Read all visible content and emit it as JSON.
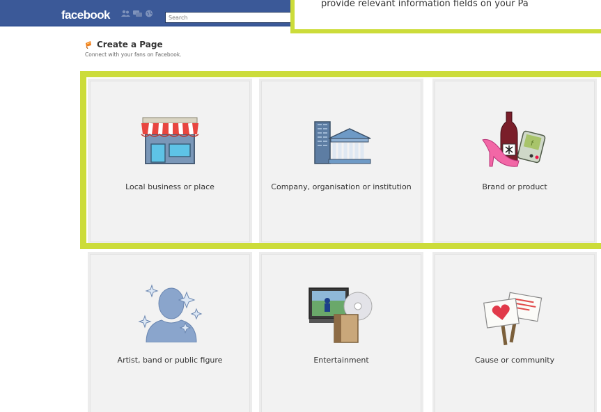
{
  "header": {
    "logo": "facebook",
    "search_placeholder": "Search",
    "brand_color": "#3b5998"
  },
  "callout": {
    "text": "provide relevant information fields on your Pa",
    "border_color": "#ccdc3a"
  },
  "page": {
    "title": "Create a Page",
    "subtitle": "Connect with your fans on Facebook."
  },
  "categories": [
    {
      "label": "Local business or place",
      "icon": "storefront-icon"
    },
    {
      "label": "Company, organisation or institution",
      "icon": "building-icon"
    },
    {
      "label": "Brand or product",
      "icon": "products-icon"
    },
    {
      "label": "Artist, band or public figure",
      "icon": "silhouette-icon"
    },
    {
      "label": "Entertainment",
      "icon": "media-icon"
    },
    {
      "label": "Cause or community",
      "icon": "placards-icon"
    }
  ]
}
